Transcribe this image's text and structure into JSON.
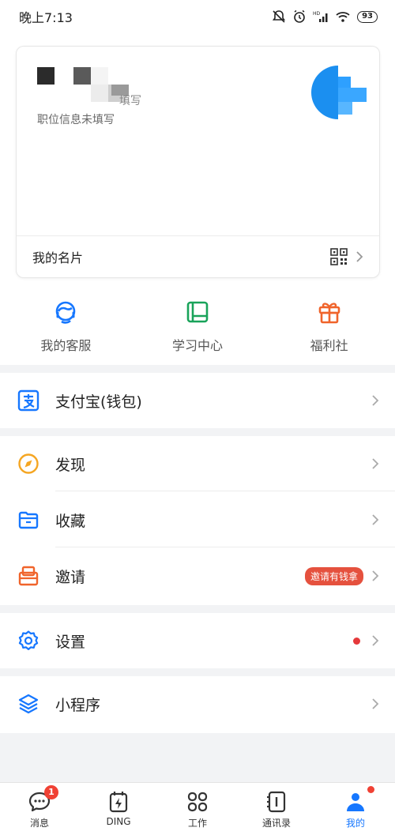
{
  "status_bar": {
    "time": "晚上7:13",
    "battery": "93"
  },
  "profile_card": {
    "name_partial": "填写",
    "position_text": "职位信息未填写",
    "card_label": "我的名片"
  },
  "quick_actions": [
    {
      "label": "我的客服",
      "icon": "customer-service-icon",
      "color": "#1677ff"
    },
    {
      "label": "学习中心",
      "icon": "book-icon",
      "color": "#19a35a"
    },
    {
      "label": "福利社",
      "icon": "gift-icon",
      "color": "#f0642b"
    }
  ],
  "menu": {
    "alipay": "支付宝(钱包)",
    "discover": "发现",
    "favorites": "收藏",
    "invite": "邀请",
    "invite_badge": "邀请有钱拿",
    "settings": "设置",
    "mini_programs": "小程序"
  },
  "tabbar": {
    "tabs": [
      {
        "label": "消息",
        "badge": "1"
      },
      {
        "label": "DING"
      },
      {
        "label": "工作"
      },
      {
        "label": "通讯录"
      },
      {
        "label": "我的"
      }
    ]
  },
  "colors": {
    "accent": "#1677ff",
    "badge_red": "#e5513e"
  }
}
